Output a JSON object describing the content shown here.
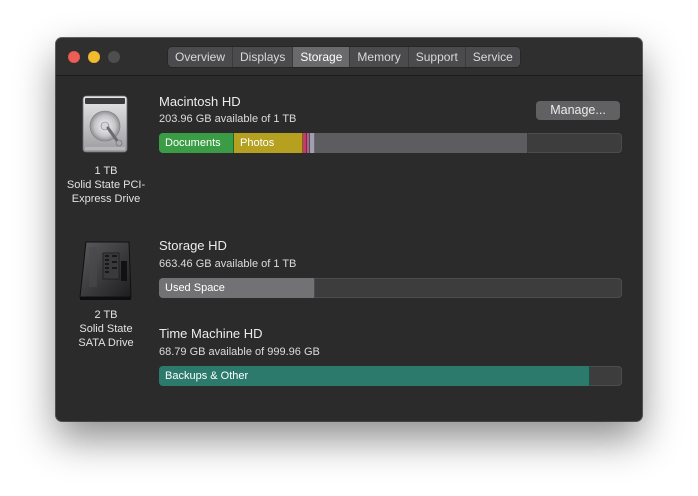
{
  "window": {
    "traffic_lights": [
      "close",
      "minimize",
      "maximize"
    ]
  },
  "tabs": [
    {
      "label": "Overview",
      "active": false
    },
    {
      "label": "Displays",
      "active": false
    },
    {
      "label": "Storage",
      "active": true
    },
    {
      "label": "Memory",
      "active": false
    },
    {
      "label": "Support",
      "active": false
    },
    {
      "label": "Service",
      "active": false
    }
  ],
  "drives": {
    "ssd": {
      "capacity": "1 TB",
      "type_line1": "Solid State PCI-",
      "type_line2": "Express Drive",
      "icon": "internal-hard-drive-icon"
    },
    "sata": {
      "capacity": "2 TB",
      "type_line1": "Solid State",
      "type_line2": "SATA Drive",
      "icon": "sata-ssd-icon"
    }
  },
  "volumes": {
    "macintosh": {
      "name": "Macintosh HD",
      "available": "203.96 GB available of 1 TB",
      "manage_label": "Manage...",
      "segments": {
        "documents": {
          "label": "Documents",
          "fraction": 0.163,
          "color": "#3a9c44"
        },
        "photos": {
          "label": "Photos",
          "fraction": 0.148,
          "color": "#b5a020"
        },
        "red": {
          "fraction": 0.008,
          "color": "#c8386a"
        },
        "pink": {
          "fraction": 0.006,
          "color": "#9a6c8a"
        },
        "lavender": {
          "fraction": 0.01,
          "color": "#a39db0"
        },
        "other": {
          "fraction": 0.46,
          "color": "#5d5d5f"
        }
      }
    },
    "storage": {
      "name": "Storage HD",
      "available": "663.46 GB available of 1 TB",
      "segments": {
        "used": {
          "label": "Used Space",
          "fraction": 0.337,
          "color": "#727274"
        }
      }
    },
    "time_machine": {
      "name": "Time Machine HD",
      "available": "68.79 GB available of 999.96 GB",
      "segments": {
        "backups": {
          "label": "Backups & Other",
          "fraction": 0.931,
          "color": "#2b7a6c"
        }
      }
    }
  }
}
